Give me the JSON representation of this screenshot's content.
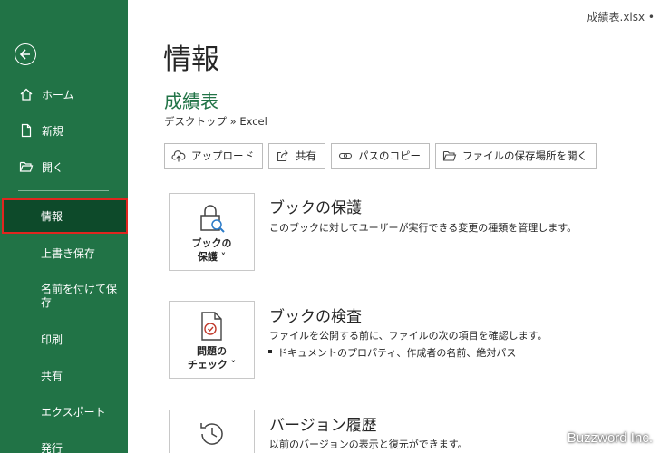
{
  "window": {
    "filename": "成績表.xlsx •"
  },
  "sidebar": {
    "back_icon": "back-arrow-icon",
    "items": [
      {
        "label": "ホーム",
        "icon": "home-icon"
      },
      {
        "label": "新規",
        "icon": "new-document-icon"
      },
      {
        "label": "開く",
        "icon": "folder-open-icon"
      },
      {
        "label": "情報"
      },
      {
        "label": "上書き保存"
      },
      {
        "label": "名前を付けて保存"
      },
      {
        "label": "印刷"
      },
      {
        "label": "共有"
      },
      {
        "label": "エクスポート"
      },
      {
        "label": "発行"
      }
    ],
    "selected": "情報",
    "colors": {
      "background": "#217346",
      "selected": "#0d4a2a",
      "highlight": "#e0261f"
    }
  },
  "main": {
    "page_title": "情報",
    "doc_title": "成績表",
    "doc_path": "デスクトップ » Excel",
    "actions": [
      {
        "label": "アップロード",
        "icon": "cloud-upload-icon"
      },
      {
        "label": "共有",
        "icon": "share-icon"
      },
      {
        "label": "パスのコピー",
        "icon": "link-icon"
      },
      {
        "label": "ファイルの保存場所を開く",
        "icon": "folder-icon"
      }
    ],
    "sections": [
      {
        "tile_line1": "ブックの",
        "tile_line2": "保護 ˅",
        "icon": "lock-icon",
        "title": "ブックの保護",
        "desc": "このブックに対してユーザーが実行できる変更の種類を管理します。"
      },
      {
        "tile_line1": "問題の",
        "tile_line2": "チェック ˅",
        "icon": "inspect-document-icon",
        "title": "ブックの検査",
        "desc": "ファイルを公開する前に、ファイルの次の項目を確認します。",
        "bullets": [
          "ドキュメントのプロパティ、作成者の名前、絶対パス"
        ]
      },
      {
        "icon": "history-clock-icon",
        "title": "バージョン履歴",
        "desc": "以前のバージョンの表示と復元ができます。"
      }
    ]
  },
  "watermark": "Buzzword Inc."
}
